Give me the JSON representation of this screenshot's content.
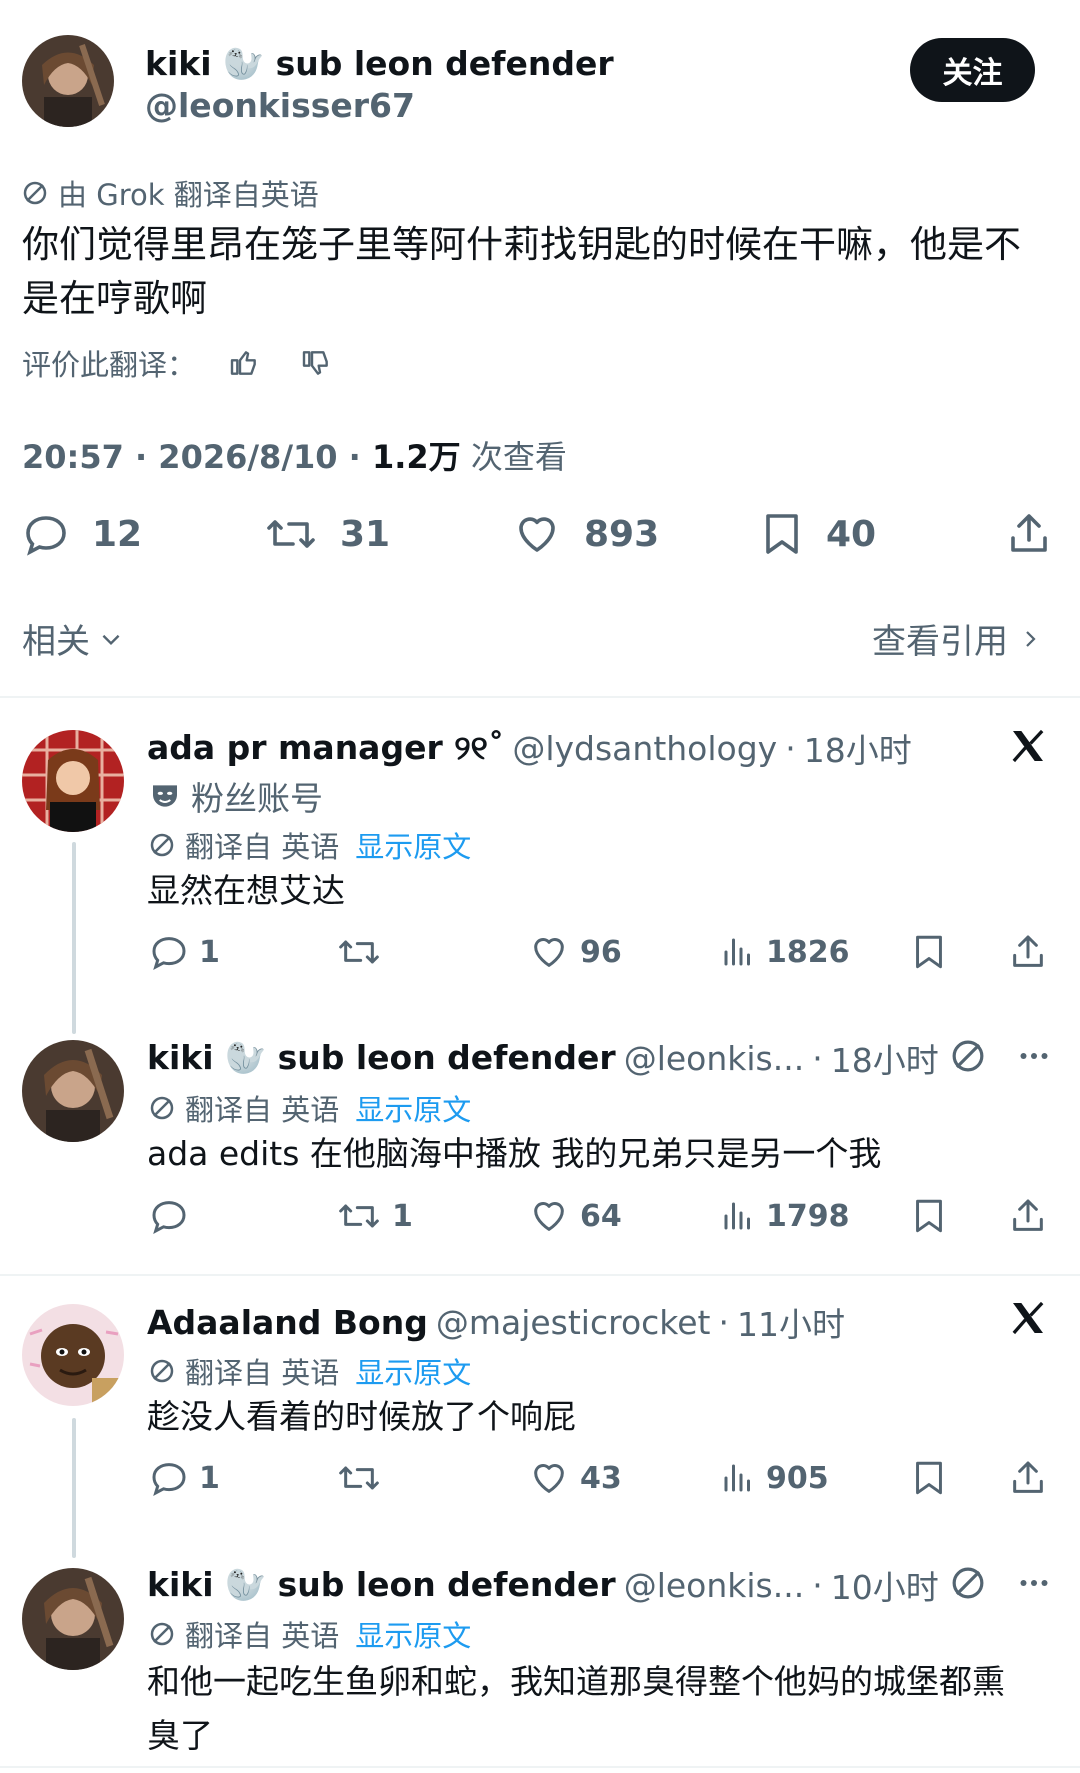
{
  "main_tweet": {
    "author_name": "kiki 🦭 sub leon defender",
    "handle": "@leonkisser67",
    "follow_label": "关注",
    "translation_note": "由 Grok 翻译自英语",
    "text": "你们觉得里昂在笼子里等阿什莉找钥匙的时候在干嘛，他是不是在哼歌啊",
    "rate_label": "评价此翻译：",
    "time": "20:57",
    "date": "2026/8/10",
    "views_count": "1.2万",
    "views_label": "次查看",
    "stats": {
      "replies": "12",
      "retweets": "31",
      "likes": "893",
      "bookmarks": "40"
    },
    "related_label": "相关",
    "quotes_label": "查看引用"
  },
  "replies": [
    {
      "author_name": "ada pr manager ୨୧˚",
      "handle": "@lydsanthology",
      "time": "18小时",
      "badge": "粉丝账号",
      "translation_prefix": "翻译自 英语",
      "show_original": "显示原文",
      "text": "显然在想艾达",
      "stats": {
        "replies": "1",
        "retweets": "",
        "likes": "96",
        "views": "1826"
      }
    },
    {
      "author_name": "kiki 🦭 sub leon defender",
      "handle": "@leonkis...",
      "time": "18小时",
      "translation_prefix": "翻译自 英语",
      "show_original": "显示原文",
      "text": "ada edits 在他脑海中播放 我的兄弟只是另一个我",
      "stats": {
        "replies": "",
        "retweets": "1",
        "likes": "64",
        "views": "1798"
      }
    },
    {
      "author_name": "Adaaland Bong",
      "handle": "@majesticrocket",
      "time": "11小时",
      "translation_prefix": "翻译自 英语",
      "show_original": "显示原文",
      "text": "趁没人看着的时候放了个响屁",
      "stats": {
        "replies": "1",
        "retweets": "",
        "likes": "43",
        "views": "905"
      }
    },
    {
      "author_name": "kiki 🦭 sub leon defender",
      "handle": "@leonkis...",
      "time": "10小时",
      "translation_prefix": "翻译自 英语",
      "show_original": "显示原文",
      "text": "和他一起吃生鱼卵和蛇，我知道那臭得整个他妈的城堡都熏臭了"
    }
  ],
  "colors": {
    "text": "#0f1419",
    "secondary": "#536471",
    "link": "#1d9bf0",
    "button": "#0f1419"
  }
}
